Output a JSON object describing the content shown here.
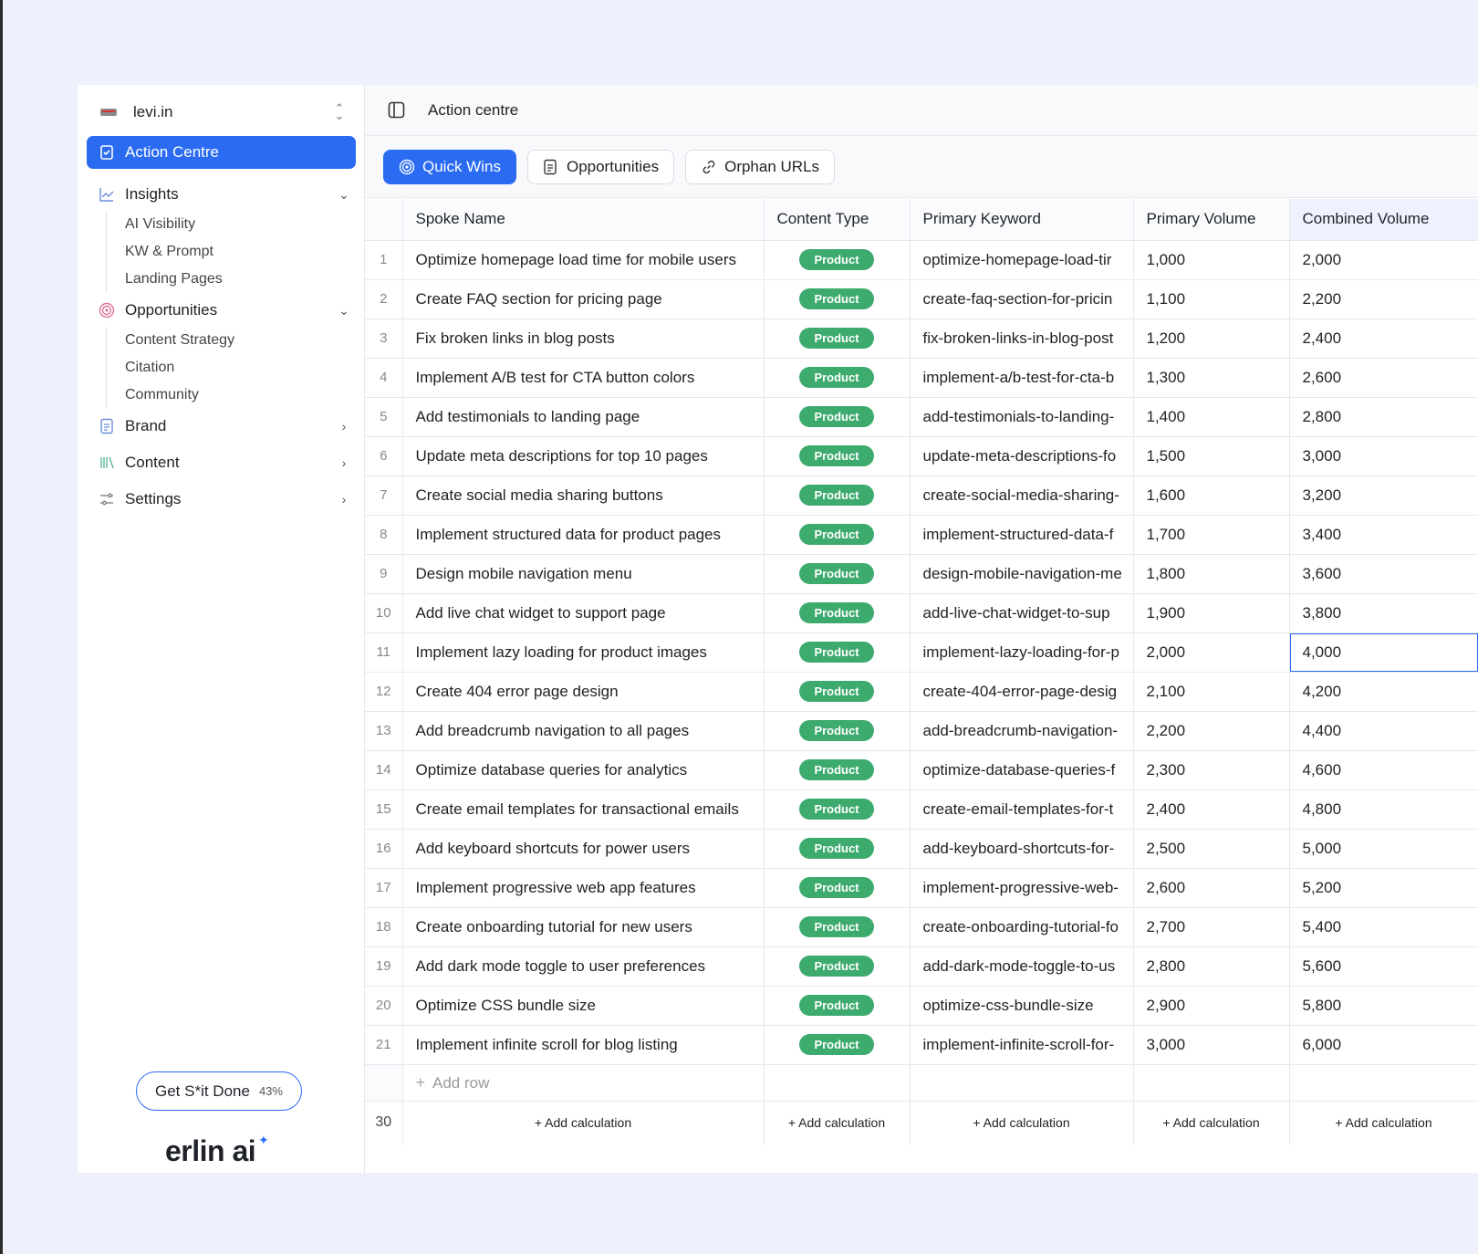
{
  "workspace": {
    "name": "levi.in"
  },
  "nav": {
    "active": "Action Centre",
    "insights": {
      "label": "Insights",
      "children": [
        "AI Visibility",
        "KW & Prompt",
        "Landing Pages"
      ]
    },
    "opportunities": {
      "label": "Opportunities",
      "children": [
        "Content Strategy",
        "Citation",
        "Community"
      ]
    },
    "brand": "Brand",
    "content": "Content",
    "settings": "Settings"
  },
  "promo": {
    "label": "Get S*it Done",
    "percent": "43%"
  },
  "brand_logo": "erlin ai",
  "topbar": {
    "title": "Action centre"
  },
  "tabs": [
    {
      "label": "Quick Wins",
      "active": true,
      "icon": "target-icon"
    },
    {
      "label": "Opportunities",
      "active": false,
      "icon": "document-icon"
    },
    {
      "label": "Orphan URLs",
      "active": false,
      "icon": "link-icon"
    }
  ],
  "table": {
    "columns": [
      "Spoke Name",
      "Content Type",
      "Primary Keyword",
      "Primary Volume",
      "Combined Volume"
    ],
    "rows": [
      [
        "1",
        "Optimize homepage load time for mobile users",
        "Product",
        "optimize-homepage-load-tir",
        "1,000",
        "2,000"
      ],
      [
        "2",
        "Create FAQ section for pricing page",
        "Product",
        "create-faq-section-for-pricin",
        "1,100",
        "2,200"
      ],
      [
        "3",
        "Fix broken links in blog posts",
        "Product",
        "fix-broken-links-in-blog-post",
        "1,200",
        "2,400"
      ],
      [
        "4",
        "Implement A/B test for CTA button colors",
        "Product",
        "implement-a/b-test-for-cta-b",
        "1,300",
        "2,600"
      ],
      [
        "5",
        "Add testimonials to landing page",
        "Product",
        "add-testimonials-to-landing-",
        "1,400",
        "2,800"
      ],
      [
        "6",
        "Update meta descriptions for top 10 pages",
        "Product",
        "update-meta-descriptions-fo",
        "1,500",
        "3,000"
      ],
      [
        "7",
        "Create social media sharing buttons",
        "Product",
        "create-social-media-sharing-",
        "1,600",
        "3,200"
      ],
      [
        "8",
        "Implement structured data for product pages",
        "Product",
        "implement-structured-data-f",
        "1,700",
        "3,400"
      ],
      [
        "9",
        "Design mobile navigation menu",
        "Product",
        "design-mobile-navigation-me",
        "1,800",
        "3,600"
      ],
      [
        "10",
        "Add live chat widget to support page",
        "Product",
        "add-live-chat-widget-to-sup",
        "1,900",
        "3,800"
      ],
      [
        "11",
        "Implement lazy loading for product images",
        "Product",
        "implement-lazy-loading-for-p",
        "2,000",
        "4,000"
      ],
      [
        "12",
        "Create 404 error page design",
        "Product",
        "create-404-error-page-desig",
        "2,100",
        "4,200"
      ],
      [
        "13",
        "Add breadcrumb navigation to all pages",
        "Product",
        "add-breadcrumb-navigation-",
        "2,200",
        "4,400"
      ],
      [
        "14",
        "Optimize database queries for analytics",
        "Product",
        "optimize-database-queries-f",
        "2,300",
        "4,600"
      ],
      [
        "15",
        "Create email templates for transactional emails",
        "Product",
        "create-email-templates-for-t",
        "2,400",
        "4,800"
      ],
      [
        "16",
        "Add keyboard shortcuts for power users",
        "Product",
        "add-keyboard-shortcuts-for-",
        "2,500",
        "5,000"
      ],
      [
        "17",
        "Implement progressive web app features",
        "Product",
        "implement-progressive-web-",
        "2,600",
        "5,200"
      ],
      [
        "18",
        "Create onboarding tutorial for new users",
        "Product",
        "create-onboarding-tutorial-fo",
        "2,700",
        "5,400"
      ],
      [
        "19",
        "Add dark mode toggle to user preferences",
        "Product",
        "add-dark-mode-toggle-to-us",
        "2,800",
        "5,600"
      ],
      [
        "20",
        "Optimize CSS bundle size",
        "Product",
        "optimize-css-bundle-size",
        "2,900",
        "5,800"
      ],
      [
        "21",
        "Implement infinite scroll for blog listing",
        "Product",
        "implement-infinite-scroll-for-",
        "3,000",
        "6,000"
      ]
    ],
    "add_row_label": "Add row",
    "footer_count": "30",
    "add_calc_label": "+ Add calculation"
  },
  "colors": {
    "accent": "#2a6bf2",
    "badge": "#3daa6e"
  }
}
